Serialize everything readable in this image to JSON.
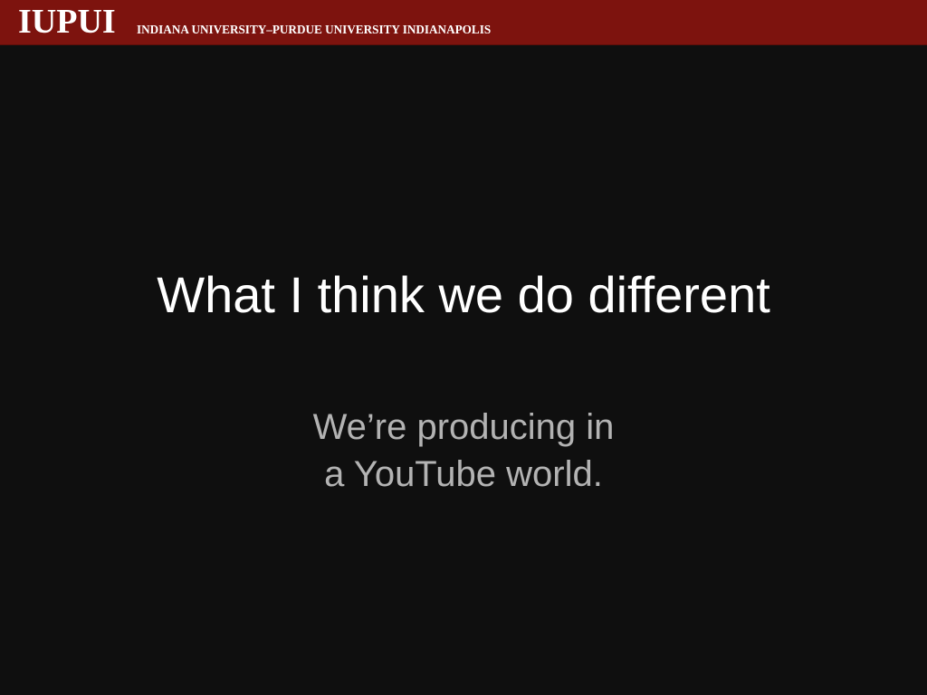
{
  "header": {
    "logo_text": "IUPUI",
    "university_name": "INDIANA UNIVERSITY–PURDUE UNIVERSITY INDIANAPOLIS",
    "background_color": "#7d130e"
  },
  "slide": {
    "title": "What I think we do different",
    "body_lines": [
      "We’re producing in",
      "a YouTube world."
    ],
    "background_color": "#0f0f0f",
    "title_color": "#ffffff",
    "body_color": "#b3b3b3"
  }
}
